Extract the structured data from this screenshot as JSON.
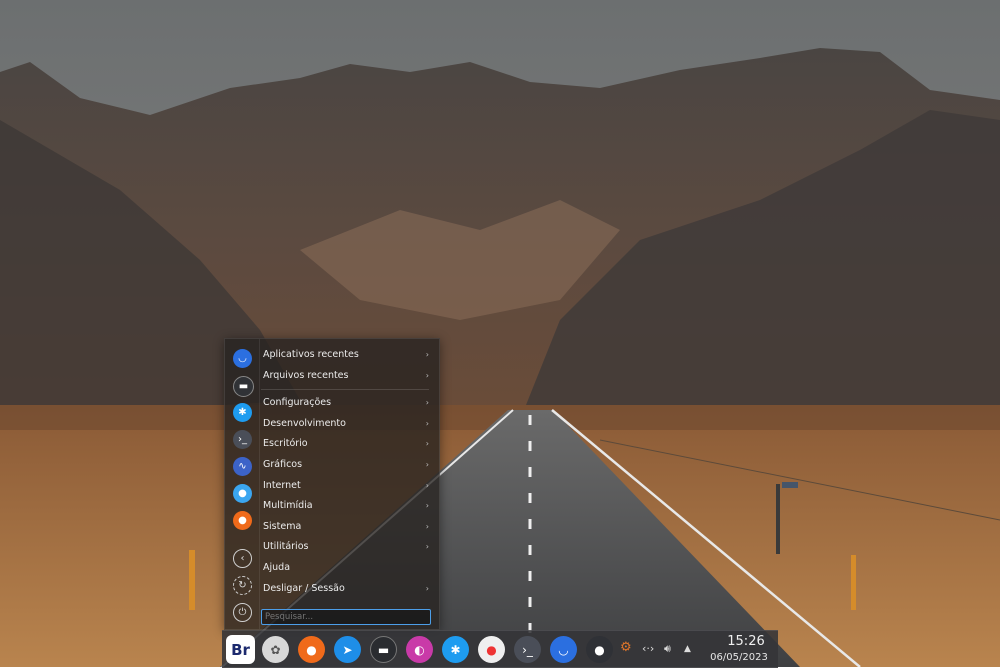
{
  "menu": {
    "categories": [
      {
        "label": "Aplicativos recentes",
        "arrow": "›"
      },
      {
        "label": "Arquivos recentes",
        "arrow": "›"
      },
      {
        "label": "Configurações",
        "arrow": "›"
      },
      {
        "label": "Desenvolvimento",
        "arrow": "›"
      },
      {
        "label": "Escritório",
        "arrow": "›"
      },
      {
        "label": "Gráficos",
        "arrow": "›"
      },
      {
        "label": "Internet",
        "arrow": "›"
      },
      {
        "label": "Multimídia",
        "arrow": "›"
      },
      {
        "label": "Sistema",
        "arrow": "›"
      },
      {
        "label": "Utilitários",
        "arrow": "›"
      },
      {
        "label": "Ajuda",
        "arrow": ""
      },
      {
        "label": "Desligar / Sessão",
        "arrow": "›"
      }
    ],
    "search_placeholder": "Pesquisar...",
    "favorites_icons": [
      "discover-icon",
      "terminal-window-icon",
      "system-settings-icon",
      "konsole-icon",
      "system-monitor-icon",
      "toggle-icon",
      "firefox-icon"
    ],
    "side_buttons": [
      "back-icon",
      "refresh-icon",
      "power-icon"
    ]
  },
  "panel": {
    "launcher_label": "Br",
    "task_icons": [
      "kde-settings-icon",
      "firefox-icon",
      "browser-compass-icon",
      "terminal-window-icon",
      "color-picker-icon",
      "system-settings-icon",
      "screen-recorder-icon",
      "konsole-icon",
      "discover-icon",
      "toggle-icon"
    ],
    "tray_icons": [
      "settings-gear-icon",
      "network-icon",
      "volume-icon",
      "expand-tray-icon"
    ],
    "clock_time": "15:26",
    "clock_date": "06/05/2023"
  },
  "colors": {
    "accent": "#3daee9",
    "panel": "#343438",
    "menu": "#262220"
  }
}
